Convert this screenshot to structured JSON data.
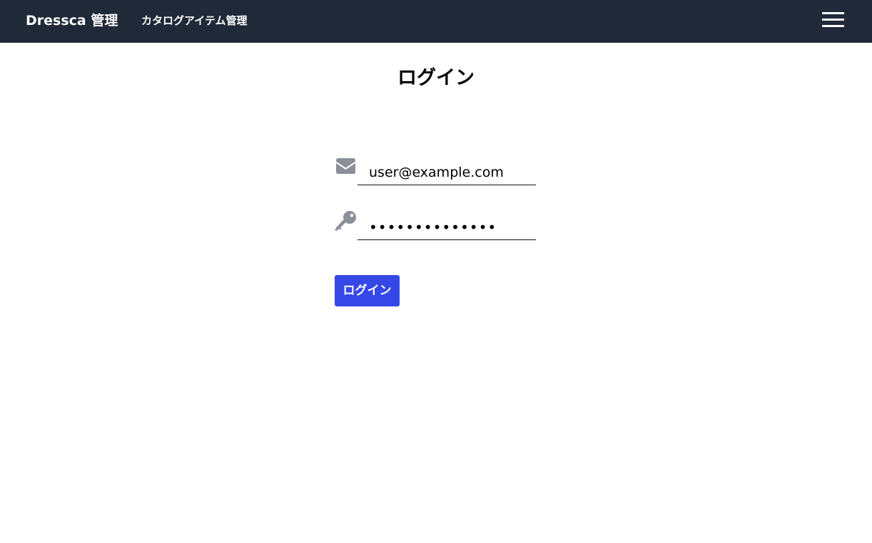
{
  "header": {
    "brand": "Dressca 管理",
    "nav_link": "カタログアイテム管理",
    "menu_icon": "hamburger-menu-icon"
  },
  "main": {
    "title": "ログイン",
    "email": {
      "icon": "envelope-icon",
      "value": "user@example.com"
    },
    "password": {
      "icon": "key-icon",
      "value": "••••••••••••••"
    },
    "login_button_label": "ログイン"
  },
  "colors": {
    "navbar_bg": "#1f2937",
    "icon_gray": "#8b8f9a",
    "button_bg": "#3647e8"
  }
}
